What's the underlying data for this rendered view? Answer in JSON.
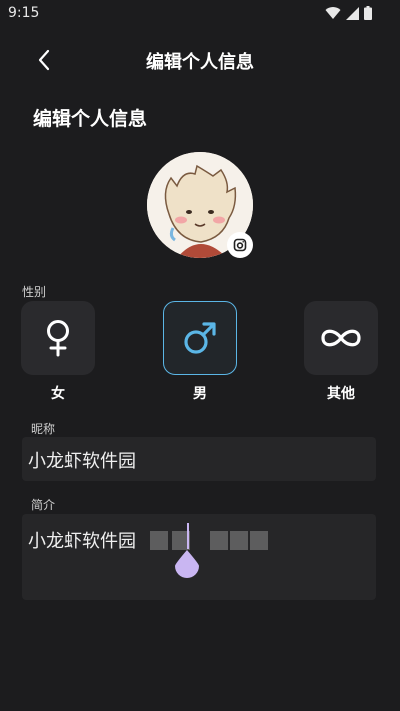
{
  "status_bar": {
    "time": "9:15"
  },
  "header": {
    "title": "编辑个人信息"
  },
  "page": {
    "heading": "编辑个人信息"
  },
  "gender": {
    "label": "性别",
    "options": [
      {
        "label": "女",
        "icon": "female-icon",
        "selected": false
      },
      {
        "label": "男",
        "icon": "male-icon",
        "selected": true
      },
      {
        "label": "其他",
        "icon": "infinity-icon",
        "selected": false
      }
    ]
  },
  "nickname": {
    "label": "昵称",
    "value": "小龙虾软件园"
  },
  "bio": {
    "label": "简介",
    "value": "小龙虾软件园"
  },
  "colors": {
    "accent": "#5bb6e6",
    "handle": "#c9b6f2",
    "background": "#1c1c1e",
    "card": "#2a2a2d"
  }
}
